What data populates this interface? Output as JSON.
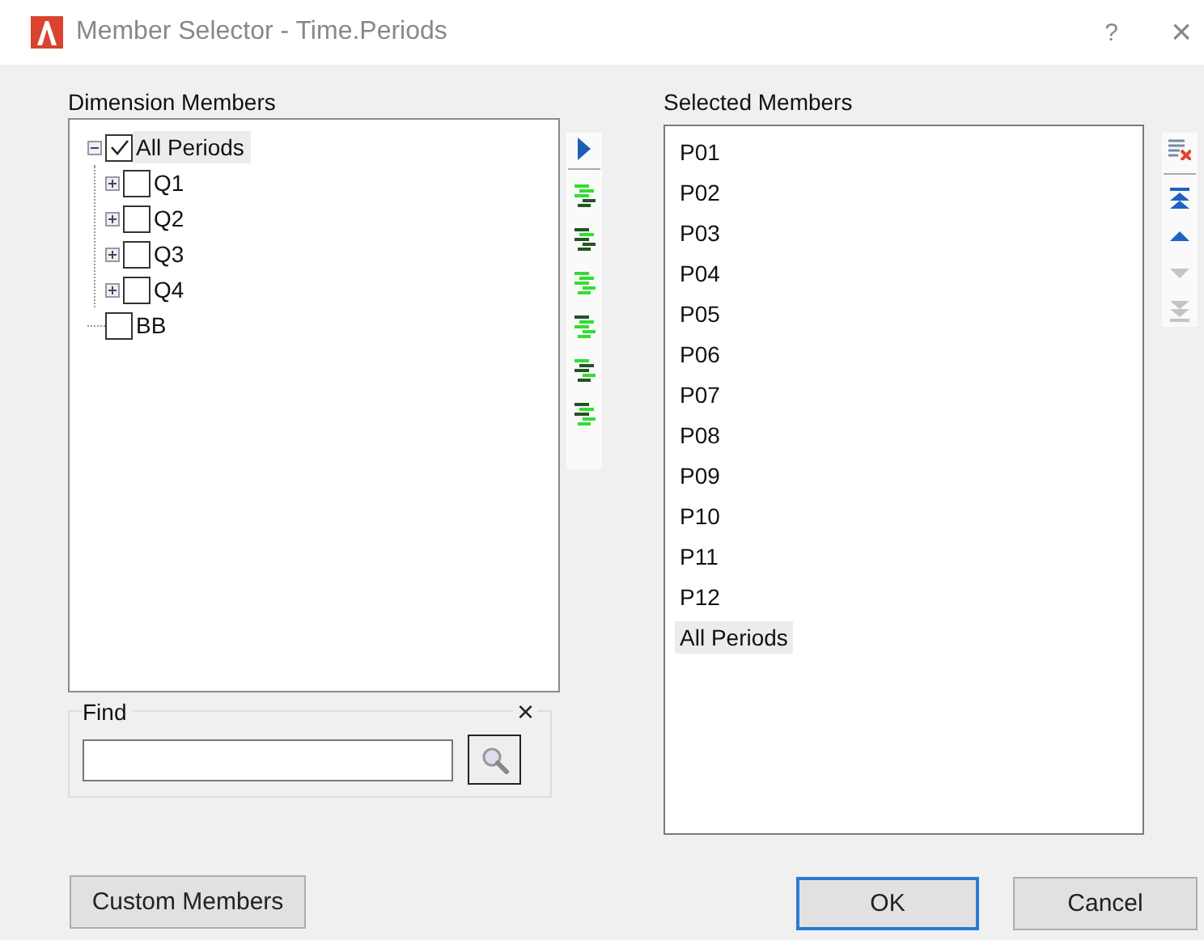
{
  "window": {
    "title": "Member Selector - Time.Periods",
    "help": "?",
    "close": "×"
  },
  "dimension_members": {
    "label": "Dimension Members",
    "tree": [
      {
        "label": "All Periods",
        "checked": true,
        "selected": true,
        "expanded": true,
        "children": [
          {
            "label": "Q1",
            "checked": false,
            "selected": false,
            "expanded": false
          },
          {
            "label": "Q2",
            "checked": false,
            "selected": false,
            "expanded": false
          },
          {
            "label": "Q3",
            "checked": false,
            "selected": false,
            "expanded": false
          },
          {
            "label": "Q4",
            "checked": false,
            "selected": false,
            "expanded": false
          }
        ]
      },
      {
        "label": "BB",
        "checked": false,
        "selected": false
      }
    ]
  },
  "find": {
    "label": "Find",
    "clear": "×"
  },
  "selected_members": {
    "label": "Selected Members",
    "items": [
      {
        "label": "P01",
        "selected": false
      },
      {
        "label": "P02",
        "selected": false
      },
      {
        "label": "P03",
        "selected": false
      },
      {
        "label": "P04",
        "selected": false
      },
      {
        "label": "P05",
        "selected": false
      },
      {
        "label": "P06",
        "selected": false
      },
      {
        "label": "P07",
        "selected": false
      },
      {
        "label": "P08",
        "selected": false
      },
      {
        "label": "P09",
        "selected": false
      },
      {
        "label": "P10",
        "selected": false
      },
      {
        "label": "P11",
        "selected": false
      },
      {
        "label": "P12",
        "selected": false
      },
      {
        "label": "All Periods",
        "selected": true
      }
    ]
  },
  "order_buttons": [
    {
      "kind": "remove-all",
      "disabled": false
    },
    {
      "kind": "top",
      "disabled": false
    },
    {
      "kind": "up",
      "disabled": false
    },
    {
      "kind": "down",
      "disabled": true
    },
    {
      "kind": "bottom",
      "disabled": true
    }
  ],
  "buttons": [
    {
      "label": "Custom Members",
      "kind": "custom",
      "default": false
    },
    {
      "label": "OK",
      "kind": "ok",
      "default": true
    },
    {
      "label": "Cancel",
      "kind": "cancel",
      "default": false
    }
  ]
}
